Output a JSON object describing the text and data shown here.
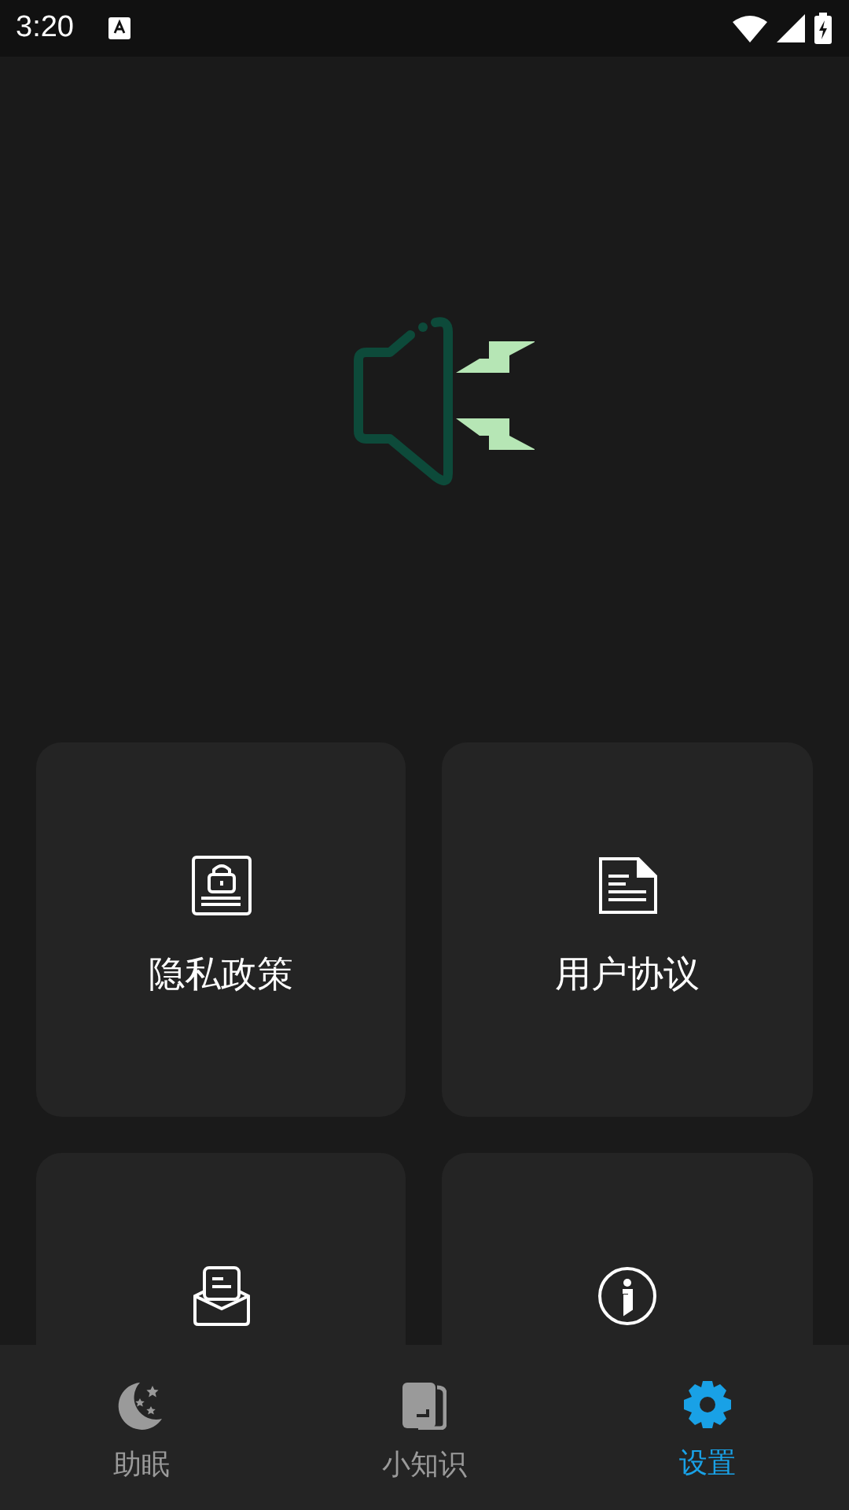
{
  "status_bar": {
    "time": "3:20"
  },
  "cards": [
    {
      "kind": "lock",
      "label": "隐私政策"
    },
    {
      "kind": "document",
      "label": "用户协议"
    },
    {
      "kind": "mail"
    },
    {
      "kind": "info"
    }
  ],
  "bottom_nav": [
    {
      "label": "助眠",
      "selected": false
    },
    {
      "label": "小知识",
      "selected": false
    },
    {
      "label": "设置",
      "selected": true
    }
  ]
}
